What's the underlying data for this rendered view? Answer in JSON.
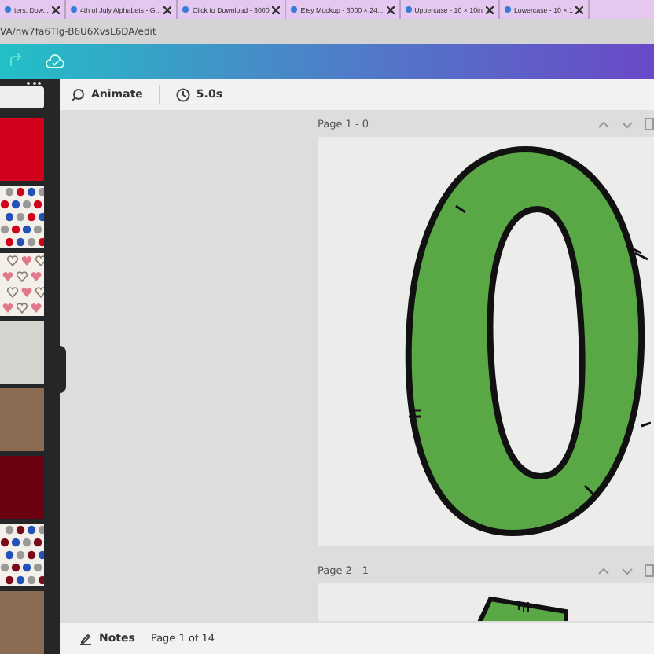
{
  "browser_tabs": [
    {
      "title": "ters, Dow...",
      "selected": false
    },
    {
      "title": "4th of July Alphabets - G...",
      "selected": false
    },
    {
      "title": "Click to Download - 3000",
      "selected": false
    },
    {
      "title": "Etsy Mockup - 3000 × 24...",
      "selected": false
    },
    {
      "title": "Uppercase - 10 × 10in",
      "selected": false
    },
    {
      "title": "Lowercase - 10 × 1",
      "selected": false
    }
  ],
  "address": "VA/nw7fa6Tlg-B6U6XvsL6DA/edit",
  "toolbar": {
    "animate": "Animate",
    "duration": "5.0s"
  },
  "swatches": [
    {
      "kind": "solid",
      "color": "#d0021b"
    },
    {
      "kind": "dots",
      "color": "#d0021b"
    },
    {
      "kind": "hearts",
      "color": "#e07a8a"
    },
    {
      "kind": "solid",
      "color": "#d3d6ce"
    },
    {
      "kind": "solid",
      "color": "#8b6b52"
    },
    {
      "kind": "solid",
      "color": "#6a0010"
    },
    {
      "kind": "dots",
      "color": "#7a0a1a"
    },
    {
      "kind": "solid",
      "color": "#8b6b52"
    }
  ],
  "pages": [
    {
      "label": "Page 1 - 0",
      "kind": "letter-o"
    },
    {
      "label": "Page 2 - 1",
      "kind": "partial"
    }
  ],
  "footer": {
    "notes": "Notes",
    "page_count": "Page 1 of 14"
  }
}
